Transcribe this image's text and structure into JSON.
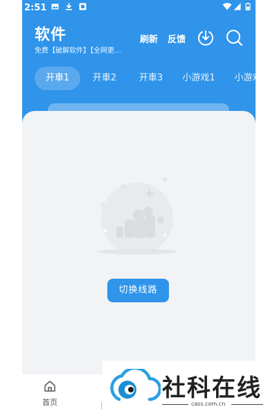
{
  "status_bar": {
    "time": "2:51"
  },
  "header": {
    "title": "软件",
    "subtitle": "免费【破解软件】【全网更…",
    "refresh_label": "刷新",
    "feedback_label": "反馈",
    "download_icon": "download-circle-icon",
    "search_icon": "search-icon"
  },
  "tabs": [
    {
      "label": "开車1",
      "active": true
    },
    {
      "label": "开車2",
      "active": false
    },
    {
      "label": "开車3",
      "active": false
    },
    {
      "label": "小游戏1",
      "active": false
    },
    {
      "label": "小游戏",
      "active": false
    }
  ],
  "content": {
    "switch_button_label": "切换线路"
  },
  "bottom_nav": {
    "home_label": "首页",
    "home_icon": "home-icon"
  },
  "watermark": {
    "text": "社科在线",
    "url": "cass.com.cn"
  },
  "colors": {
    "primary": "#2f94ea",
    "card_bg": "#f1f3f5"
  }
}
